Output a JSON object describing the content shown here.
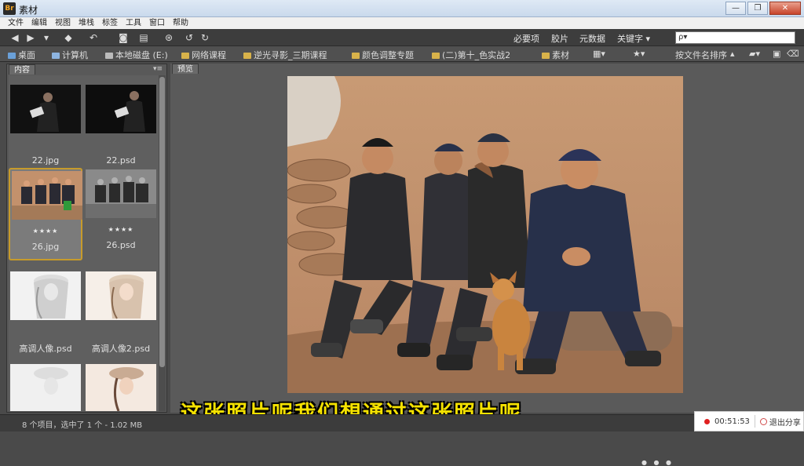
{
  "window": {
    "app_badge": "Br",
    "title": "素材",
    "buttons": [
      "—",
      "❐",
      "✕"
    ]
  },
  "menu": [
    "文件",
    "编辑",
    "视图",
    "堆栈",
    "标签",
    "工具",
    "窗口",
    "帮助"
  ],
  "toolbar": {
    "workspaces": [
      "必要项",
      "胶片",
      "元数据",
      "关键字 ▾"
    ],
    "search_placeholder": "ρ▾"
  },
  "path": {
    "crumbs": [
      "桌面",
      "计算机",
      "本地磁盘 (E:)",
      "网络课程",
      "逆光寻影_三期课程",
      "颜色调整专题",
      "(二)第十_色实战2",
      "素材"
    ],
    "sort_label": "按文件名排序"
  },
  "content_panel": {
    "tab_label": "内容",
    "thumbnails": [
      {
        "name": "22.jpg",
        "stars": ""
      },
      {
        "name": "22.psd",
        "stars": ""
      },
      {
        "name": "26.jpg",
        "stars": "★★★★",
        "selected": true
      },
      {
        "name": "26.psd",
        "stars": "★★★★"
      },
      {
        "name": "高调人像.psd",
        "stars": ""
      },
      {
        "name": "高调人像2.psd",
        "stars": ""
      },
      {
        "name": "",
        "stars": ""
      },
      {
        "name": "",
        "stars": ""
      }
    ]
  },
  "preview_panel": {
    "tab_label": "预览"
  },
  "status": {
    "text": "8 个项目，选中了 1 个 - 1.02 MB"
  },
  "subtitle": "这张照片呢我们想通过这张照片呢",
  "recording": {
    "time": "00:51:53",
    "exit_label": "退出分享"
  },
  "colors": {
    "accent": "#c79b2b",
    "subtitle": "#f5e200"
  }
}
